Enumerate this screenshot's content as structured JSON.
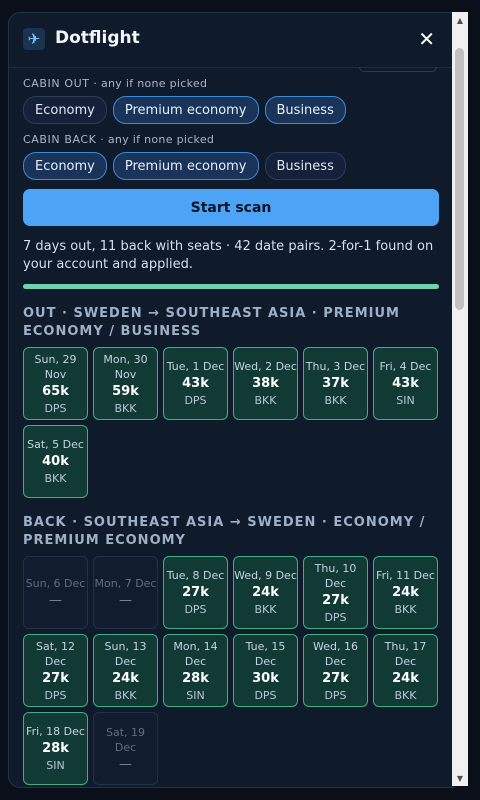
{
  "app": {
    "name": "Dotflight",
    "logo_icon": "✈",
    "close_icon": "✕"
  },
  "cabin_out": {
    "label": "CABIN OUT",
    "hint": "· any if none picked",
    "options": [
      {
        "label": "Economy",
        "selected": false
      },
      {
        "label": "Premium economy",
        "selected": true
      },
      {
        "label": "Business",
        "selected": true
      }
    ]
  },
  "cabin_back": {
    "label": "CABIN BACK",
    "hint": "· any if none picked",
    "options": [
      {
        "label": "Economy",
        "selected": true
      },
      {
        "label": "Premium economy",
        "selected": true
      },
      {
        "label": "Business",
        "selected": false
      }
    ]
  },
  "scan_button": "Start scan",
  "status_text": "7 days out, 11 back with seats · 42 date pairs. 2-for-1 found on your account and applied.",
  "progress": 1.0,
  "outbound": {
    "title": "OUT · SWEDEN → SOUTHEAST ASIA · PREMIUM ECONOMY / BUSINESS",
    "days": [
      {
        "date": "Sun, 29 Nov",
        "points": "65k",
        "airport": "DPS",
        "available": true
      },
      {
        "date": "Mon, 30 Nov",
        "points": "59k",
        "airport": "BKK",
        "available": true
      },
      {
        "date": "Tue, 1 Dec",
        "points": "43k",
        "airport": "DPS",
        "available": true
      },
      {
        "date": "Wed, 2 Dec",
        "points": "38k",
        "airport": "BKK",
        "available": true
      },
      {
        "date": "Thu, 3 Dec",
        "points": "37k",
        "airport": "BKK",
        "available": true
      },
      {
        "date": "Fri, 4 Dec",
        "points": "43k",
        "airport": "SIN",
        "available": true
      },
      {
        "date": "Sat, 5 Dec",
        "points": "40k",
        "airport": "BKK",
        "available": true
      }
    ]
  },
  "return": {
    "title": "BACK · SOUTHEAST ASIA → SWEDEN · ECONOMY / PREMIUM ECONOMY",
    "days": [
      {
        "date": "Sun, 6 Dec",
        "points": "—",
        "airport": "",
        "available": false
      },
      {
        "date": "Mon, 7 Dec",
        "points": "—",
        "airport": "",
        "available": false
      },
      {
        "date": "Tue, 8 Dec",
        "points": "27k",
        "airport": "DPS",
        "available": true
      },
      {
        "date": "Wed, 9 Dec",
        "points": "24k",
        "airport": "BKK",
        "available": true
      },
      {
        "date": "Thu, 10 Dec",
        "points": "27k",
        "airport": "DPS",
        "available": true
      },
      {
        "date": "Fri, 11 Dec",
        "points": "24k",
        "airport": "BKK",
        "available": true
      },
      {
        "date": "Sat, 12 Dec",
        "points": "27k",
        "airport": "DPS",
        "available": true
      },
      {
        "date": "Sun, 13 Dec",
        "points": "24k",
        "airport": "BKK",
        "available": true
      },
      {
        "date": "Mon, 14 Dec",
        "points": "28k",
        "airport": "SIN",
        "available": true
      },
      {
        "date": "Tue, 15 Dec",
        "points": "30k",
        "airport": "DPS",
        "available": true
      },
      {
        "date": "Wed, 16 Dec",
        "points": "27k",
        "airport": "DPS",
        "available": true
      },
      {
        "date": "Thu, 17 Dec",
        "points": "24k",
        "airport": "BKK",
        "available": true
      },
      {
        "date": "Fri, 18 Dec",
        "points": "28k",
        "airport": "SIN",
        "available": true
      },
      {
        "date": "Sat, 19 Dec",
        "points": "—",
        "airport": "",
        "available": false
      }
    ]
  },
  "scrollbar": {
    "up_icon": "▲",
    "down_icon": "▼"
  }
}
